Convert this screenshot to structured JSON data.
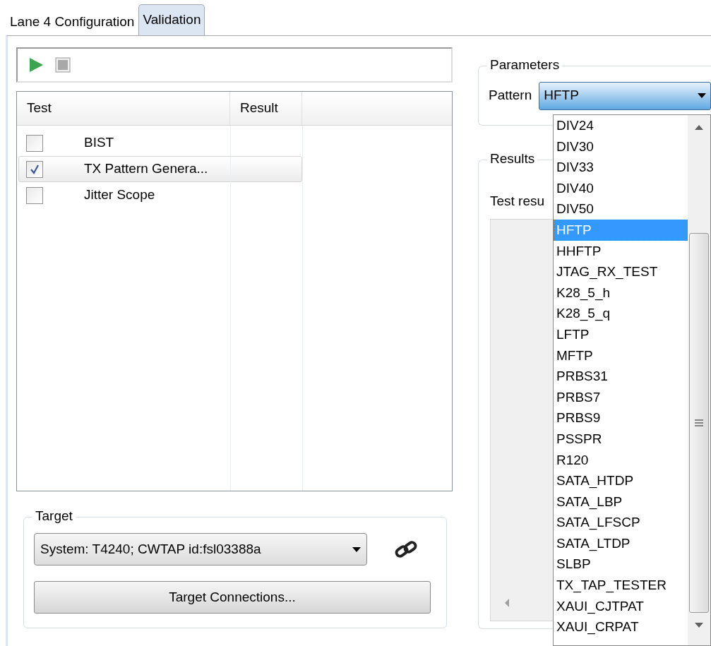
{
  "tabs": [
    {
      "label": "Lane 4 Configuration",
      "selected": false
    },
    {
      "label": "Validation",
      "selected": true
    }
  ],
  "toolbar": {
    "buttons": [
      {
        "kind": "run",
        "disabled": false
      },
      {
        "kind": "stop",
        "disabled": true
      }
    ]
  },
  "tests_table": {
    "columns": [
      "Test",
      "Result"
    ],
    "rows": [
      {
        "name": "BIST",
        "checked": false,
        "selected": false
      },
      {
        "name": "TX Pattern Genera...",
        "checked": true,
        "selected": true
      },
      {
        "name": "Jitter Scope",
        "checked": false,
        "selected": false
      }
    ]
  },
  "target": {
    "title": "Target",
    "system": "System: T4240; CWTAP id:fsl03388a",
    "connections_button": "Target Connections..."
  },
  "parameters": {
    "title": "Parameters",
    "pattern_label": "Pattern",
    "pattern_value": "HFTP"
  },
  "results": {
    "title": "Results",
    "test_results_label": "Test resu"
  },
  "pattern_dropdown": {
    "options": [
      {
        "label": "DIV24",
        "selected": false
      },
      {
        "label": "DIV30",
        "selected": false
      },
      {
        "label": "DIV33",
        "selected": false
      },
      {
        "label": "DIV40",
        "selected": false
      },
      {
        "label": "DIV50",
        "selected": false
      },
      {
        "label": "HFTP",
        "selected": true
      },
      {
        "label": "HHFTP",
        "selected": false
      },
      {
        "label": "JTAG_RX_TEST",
        "selected": false
      },
      {
        "label": "K28_5_h",
        "selected": false
      },
      {
        "label": "K28_5_q",
        "selected": false
      },
      {
        "label": "LFTP",
        "selected": false
      },
      {
        "label": "MFTP",
        "selected": false
      },
      {
        "label": "PRBS31",
        "selected": false
      },
      {
        "label": "PRBS7",
        "selected": false
      },
      {
        "label": "PRBS9",
        "selected": false
      },
      {
        "label": "PSSPR",
        "selected": false
      },
      {
        "label": "R120",
        "selected": false
      },
      {
        "label": "SATA_HTDP",
        "selected": false
      },
      {
        "label": "SATA_LBP",
        "selected": false
      },
      {
        "label": "SATA_LFSCP",
        "selected": false
      },
      {
        "label": "SATA_LTDP",
        "selected": false
      },
      {
        "label": "SLBP",
        "selected": false
      },
      {
        "label": "TX_TAP_TESTER",
        "selected": false
      },
      {
        "label": "XAUI_CJTPAT",
        "selected": false
      },
      {
        "label": "XAUI_CRPAT",
        "selected": false
      }
    ]
  }
}
